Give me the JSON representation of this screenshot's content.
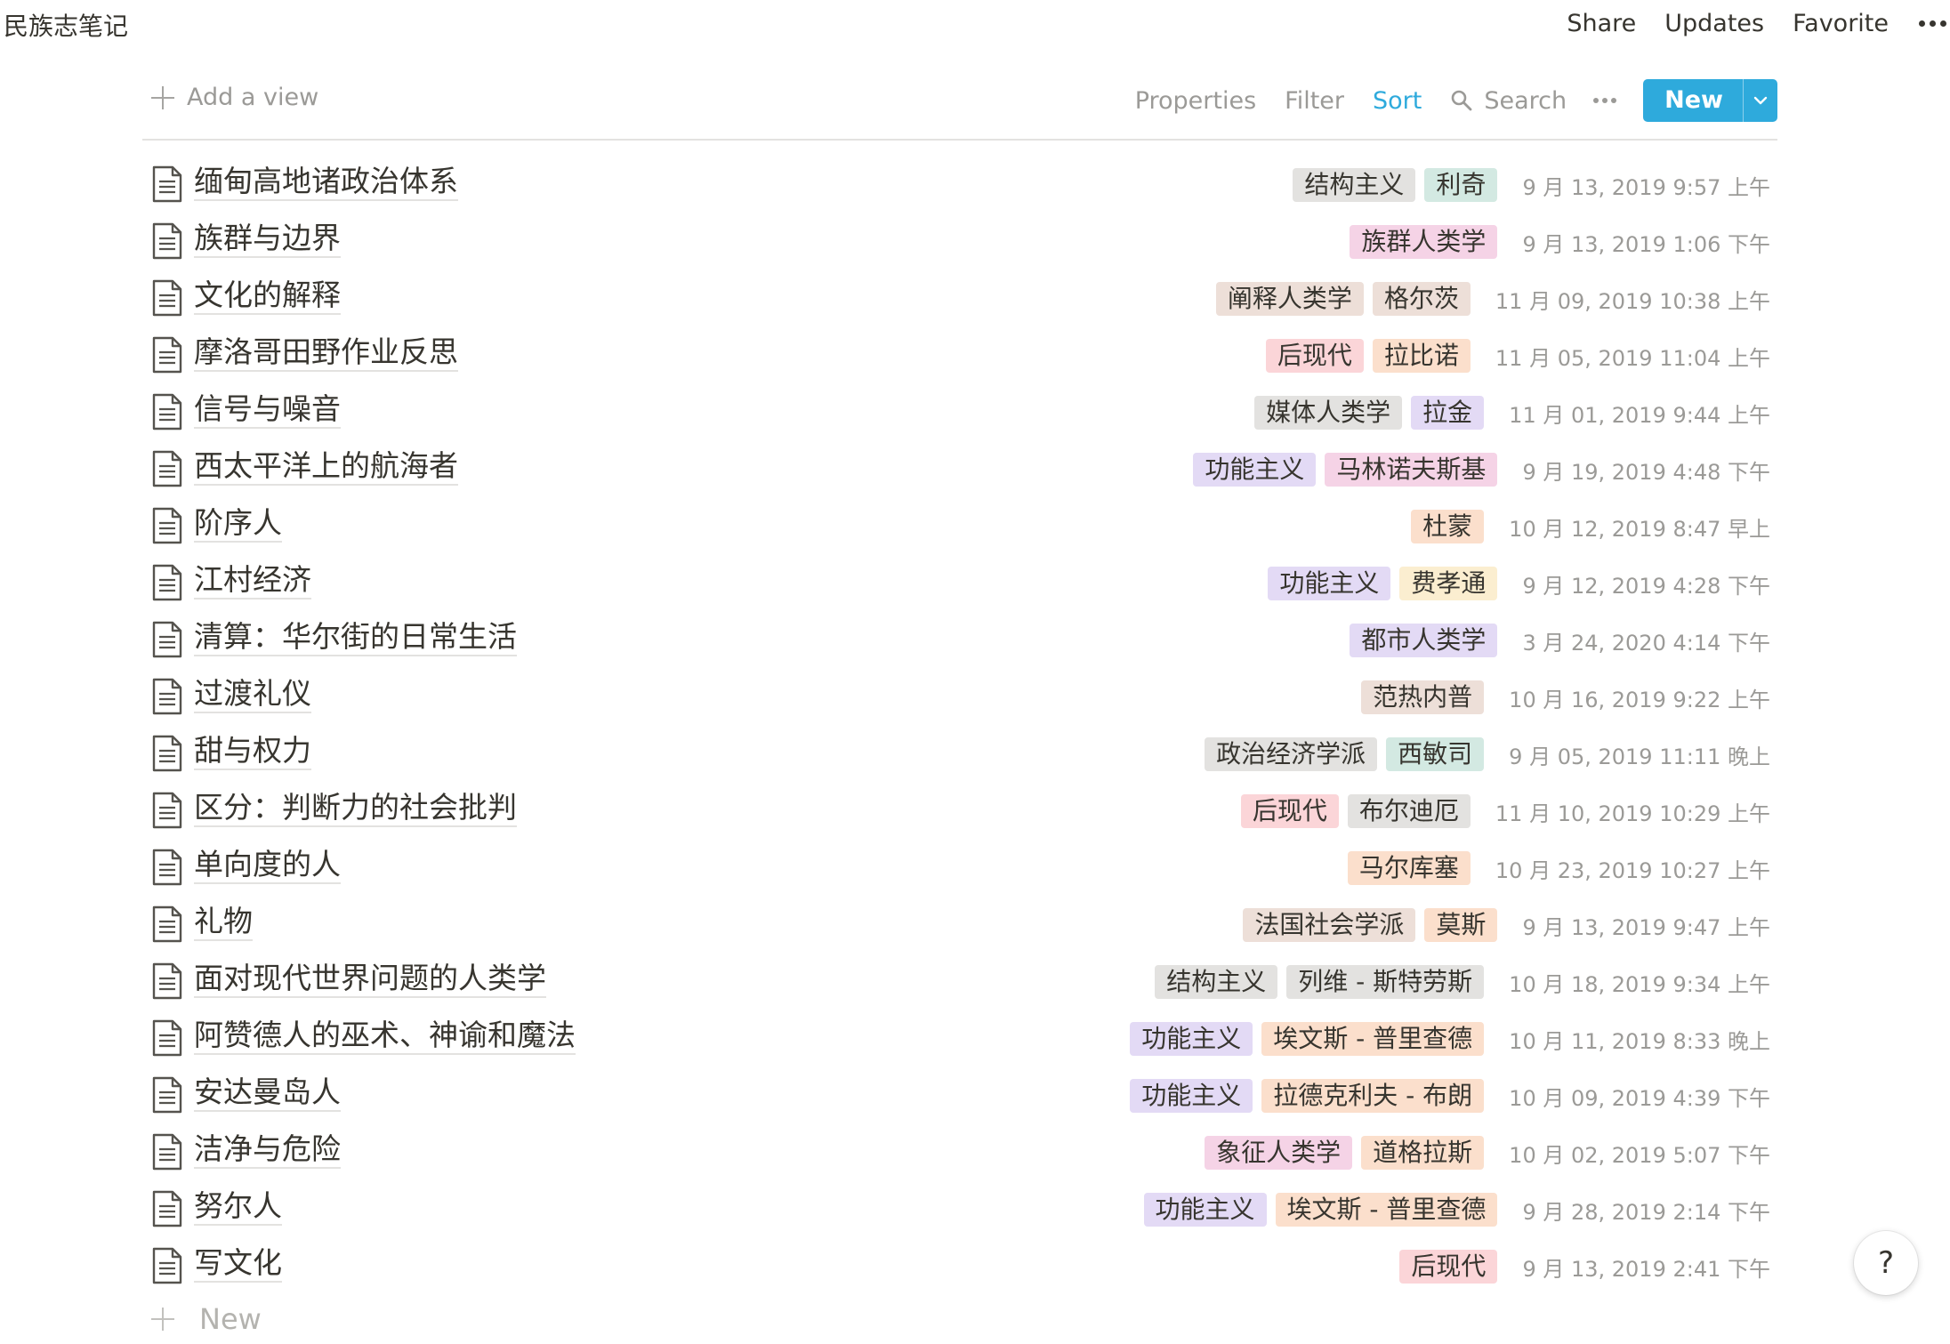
{
  "page": {
    "title": "民族志笔记"
  },
  "topbar": {
    "share": "Share",
    "updates": "Updates",
    "favorite": "Favorite",
    "more_icon": "more-horizontal-icon"
  },
  "viewbar": {
    "add_view": "Add a view",
    "properties": "Properties",
    "filter": "Filter",
    "sort": "Sort",
    "search": "Search",
    "new": "New",
    "active_color": "#2eaadc"
  },
  "rows": [
    {
      "title": "缅甸高地诸政治体系",
      "tags": [
        {
          "label": "结构主义",
          "color": "gray"
        },
        {
          "label": "利奇",
          "color": "teal"
        }
      ],
      "date": "9 月 13, 2019 9:57 上午"
    },
    {
      "title": "族群与边界",
      "tags": [
        {
          "label": "族群人类学",
          "color": "pink"
        }
      ],
      "date": "9 月 13, 2019 1:06 下午"
    },
    {
      "title": "文化的解释",
      "tags": [
        {
          "label": "阐释人类学",
          "color": "brown"
        },
        {
          "label": "格尔茨",
          "color": "brown"
        }
      ],
      "date": "11 月 09, 2019 10:38 上午"
    },
    {
      "title": "摩洛哥田野作业反思",
      "tags": [
        {
          "label": "后现代",
          "color": "red"
        },
        {
          "label": "拉比诺",
          "color": "orange"
        }
      ],
      "date": "11 月 05, 2019 11:04 上午"
    },
    {
      "title": "信号与噪音",
      "tags": [
        {
          "label": "媒体人类学",
          "color": "gray"
        },
        {
          "label": "拉金",
          "color": "purple"
        }
      ],
      "date": "11 月 01, 2019 9:44 上午"
    },
    {
      "title": "西太平洋上的航海者",
      "tags": [
        {
          "label": "功能主义",
          "color": "purple"
        },
        {
          "label": "马林诺夫斯基",
          "color": "pink"
        }
      ],
      "date": "9 月 19, 2019 4:48 下午"
    },
    {
      "title": "阶序人",
      "tags": [
        {
          "label": "杜蒙",
          "color": "orange"
        }
      ],
      "date": "10 月 12, 2019 8:47 早上"
    },
    {
      "title": "江村经济",
      "tags": [
        {
          "label": "功能主义",
          "color": "purple"
        },
        {
          "label": "费孝通",
          "color": "yellow"
        }
      ],
      "date": "9 月 12, 2019 4:28 下午"
    },
    {
      "title": "清算：华尔街的日常生活",
      "tags": [
        {
          "label": "都市人类学",
          "color": "purple"
        }
      ],
      "date": "3 月 24, 2020 4:14 下午"
    },
    {
      "title": "过渡礼仪",
      "tags": [
        {
          "label": "范热内普",
          "color": "brown"
        }
      ],
      "date": "10 月 16, 2019 9:22 上午"
    },
    {
      "title": "甜与权力",
      "tags": [
        {
          "label": "政治经济学派",
          "color": "gray"
        },
        {
          "label": "西敏司",
          "color": "teal"
        }
      ],
      "date": "9 月 05, 2019 11:11 晚上"
    },
    {
      "title": "区分：判断力的社会批判",
      "tags": [
        {
          "label": "后现代",
          "color": "red"
        },
        {
          "label": "布尔迪厄",
          "color": "gray"
        }
      ],
      "date": "11 月 10, 2019 10:29 上午"
    },
    {
      "title": "单向度的人",
      "tags": [
        {
          "label": "马尔库塞",
          "color": "orange"
        }
      ],
      "date": "10 月 23, 2019 10:27 上午"
    },
    {
      "title": "礼物",
      "tags": [
        {
          "label": "法国社会学派",
          "color": "brown"
        },
        {
          "label": "莫斯",
          "color": "orange"
        }
      ],
      "date": "9 月 13, 2019 9:47 上午"
    },
    {
      "title": "面对现代世界问题的人类学",
      "tags": [
        {
          "label": "结构主义",
          "color": "gray"
        },
        {
          "label": "列维 - 斯特劳斯",
          "color": "gray"
        }
      ],
      "date": "10 月 18, 2019 9:34 上午"
    },
    {
      "title": "阿赞德人的巫术、神谕和魔法",
      "tags": [
        {
          "label": "功能主义",
          "color": "purple"
        },
        {
          "label": "埃文斯 - 普里查德",
          "color": "orange"
        }
      ],
      "date": "10 月 11, 2019 8:33 晚上"
    },
    {
      "title": "安达曼岛人",
      "tags": [
        {
          "label": "功能主义",
          "color": "purple"
        },
        {
          "label": "拉德克利夫 - 布朗",
          "color": "orange"
        }
      ],
      "date": "10 月 09, 2019 4:39 下午"
    },
    {
      "title": "洁净与危险",
      "tags": [
        {
          "label": "象征人类学",
          "color": "pink"
        },
        {
          "label": "道格拉斯",
          "color": "orange"
        }
      ],
      "date": "10 月 02, 2019 5:07 下午"
    },
    {
      "title": "努尔人",
      "tags": [
        {
          "label": "功能主义",
          "color": "purple"
        },
        {
          "label": "埃文斯 - 普里查德",
          "color": "orange"
        }
      ],
      "date": "9 月 28, 2019 2:14 下午"
    },
    {
      "title": "写文化",
      "tags": [
        {
          "label": "后现代",
          "color": "red"
        }
      ],
      "date": "9 月 13, 2019 2:41 下午"
    }
  ],
  "footer": {
    "new_row": "New",
    "help": "?"
  }
}
